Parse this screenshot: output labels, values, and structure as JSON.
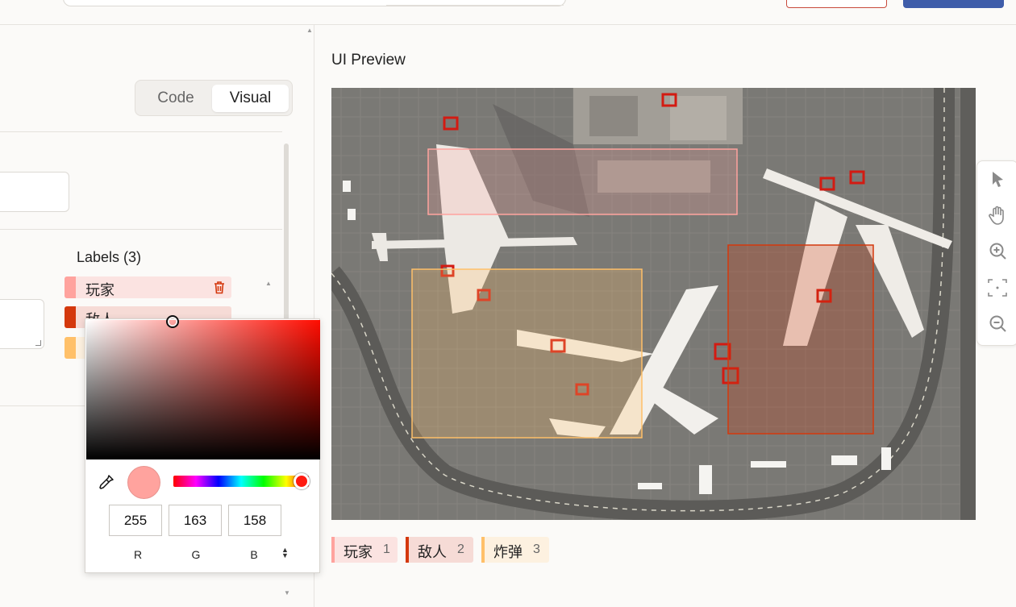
{
  "view_toggle": {
    "code_label": "Code",
    "visual_label": "Visual"
  },
  "labels_panel": {
    "title": "Labels (3)",
    "items": [
      {
        "name": "玩家",
        "color": "#ffa39e",
        "bg": "#fbe3e1"
      },
      {
        "name": "敌人",
        "color": "#d4380d",
        "bg": "#f6dbd6"
      },
      {
        "name": "炸弹",
        "color": "#ffc069",
        "bg": "#fdf1e0"
      }
    ]
  },
  "color_picker": {
    "swatch_color": "#ffa39e",
    "r": "255",
    "g": "163",
    "b": "158",
    "r_label": "R",
    "g_label": "G",
    "b_label": "B",
    "hue_color": "#ff0c00"
  },
  "preview": {
    "title": "UI Preview",
    "legend": [
      {
        "name": "玩家",
        "count": "1",
        "color": "#ffa39e"
      },
      {
        "name": "敌人",
        "count": "2",
        "color": "#d4380d"
      },
      {
        "name": "炸弹",
        "count": "3",
        "color": "#ffc069"
      }
    ]
  },
  "toolbar": {
    "tools": [
      "cursor-icon",
      "hand-pan-icon",
      "zoom-in-icon",
      "fit-screen-icon",
      "zoom-out-icon"
    ]
  }
}
